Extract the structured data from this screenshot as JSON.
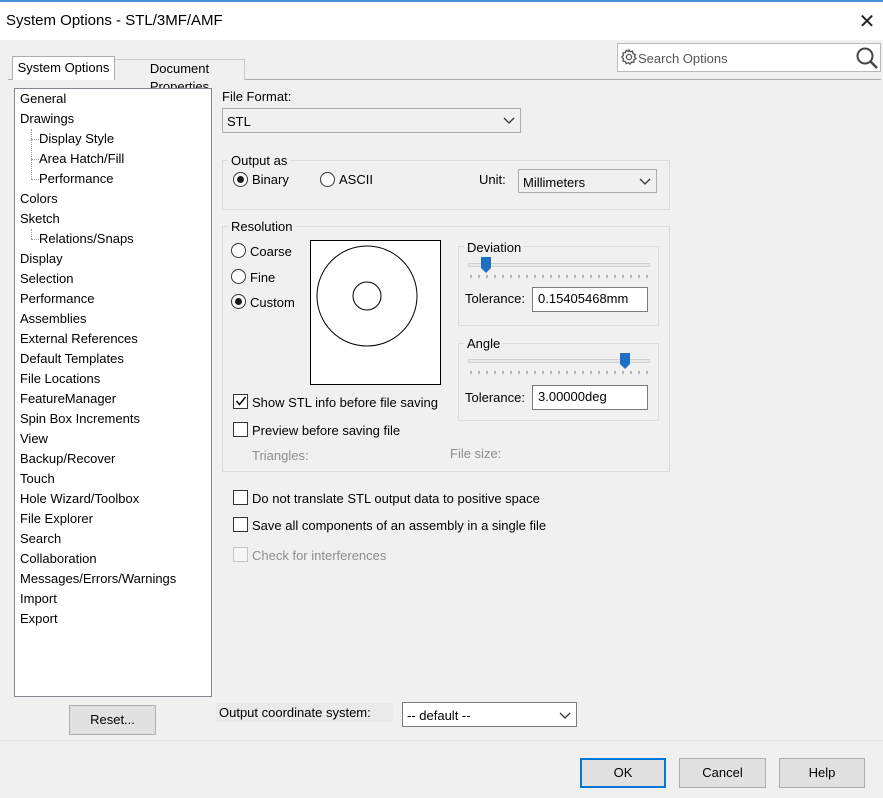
{
  "window": {
    "title": "System Options - STL/3MF/AMF",
    "close_glyph": "✕"
  },
  "search": {
    "placeholder": "Search Options",
    "gear_icon": "gear-icon",
    "magnifier_icon": "search-icon"
  },
  "tabs": [
    {
      "label": "System Options",
      "active": true
    },
    {
      "label": "Document Properties",
      "active": false
    }
  ],
  "tree": {
    "items": [
      {
        "label": "General",
        "level": 0
      },
      {
        "label": "Drawings",
        "level": 0
      },
      {
        "label": "Display Style",
        "level": 1
      },
      {
        "label": "Area Hatch/Fill",
        "level": 1
      },
      {
        "label": "Performance",
        "level": 1
      },
      {
        "label": "Colors",
        "level": 0
      },
      {
        "label": "Sketch",
        "level": 0
      },
      {
        "label": "Relations/Snaps",
        "level": 1
      },
      {
        "label": "Display",
        "level": 0
      },
      {
        "label": "Selection",
        "level": 0
      },
      {
        "label": "Performance",
        "level": 0
      },
      {
        "label": "Assemblies",
        "level": 0
      },
      {
        "label": "External References",
        "level": 0
      },
      {
        "label": "Default Templates",
        "level": 0
      },
      {
        "label": "File Locations",
        "level": 0
      },
      {
        "label": "FeatureManager",
        "level": 0
      },
      {
        "label": "Spin Box Increments",
        "level": 0
      },
      {
        "label": "View",
        "level": 0
      },
      {
        "label": "Backup/Recover",
        "level": 0
      },
      {
        "label": "Touch",
        "level": 0
      },
      {
        "label": "Hole Wizard/Toolbox",
        "level": 0
      },
      {
        "label": "File Explorer",
        "level": 0
      },
      {
        "label": "Search",
        "level": 0
      },
      {
        "label": "Collaboration",
        "level": 0
      },
      {
        "label": "Messages/Errors/Warnings",
        "level": 0
      },
      {
        "label": "Import",
        "level": 0
      },
      {
        "label": "Export",
        "level": 0
      }
    ]
  },
  "reset_label": "Reset...",
  "file_format": {
    "label": "File Format:",
    "value": "STL"
  },
  "output_as": {
    "title": "Output as",
    "binary_label": "Binary",
    "ascii_label": "ASCII",
    "selected": "Binary",
    "unit_label": "Unit:",
    "unit_value": "Millimeters"
  },
  "resolution": {
    "title": "Resolution",
    "coarse_label": "Coarse",
    "fine_label": "Fine",
    "custom_label": "Custom",
    "selected": "Custom",
    "deviation": {
      "title": "Deviation",
      "tolerance_label": "Tolerance:",
      "tolerance_value": "0.15405468mm",
      "slider_fraction": 0.09
    },
    "angle": {
      "title": "Angle",
      "tolerance_label": "Tolerance:",
      "tolerance_value": "3.00000deg",
      "slider_fraction": 0.88
    },
    "show_info_label": "Show STL info before file saving",
    "show_info_checked": true,
    "preview_label": "Preview before saving file",
    "preview_checked": false,
    "triangles_label": "Triangles:",
    "file_size_label": "File size:"
  },
  "options": {
    "no_translate_label": "Do not translate STL output data to positive space",
    "no_translate_checked": false,
    "single_file_label": "Save all components of an assembly in a single file",
    "single_file_checked": false,
    "interferences_label": "Check for interferences",
    "interferences_checked": false
  },
  "coordinate_system": {
    "label": "Output coordinate system:",
    "value": "-- default --"
  },
  "footer": {
    "ok_label": "OK",
    "cancel_label": "Cancel",
    "help_label": "Help"
  },
  "colors": {
    "accent": "#0078d7",
    "slider_thumb": "#1f6fc5"
  }
}
